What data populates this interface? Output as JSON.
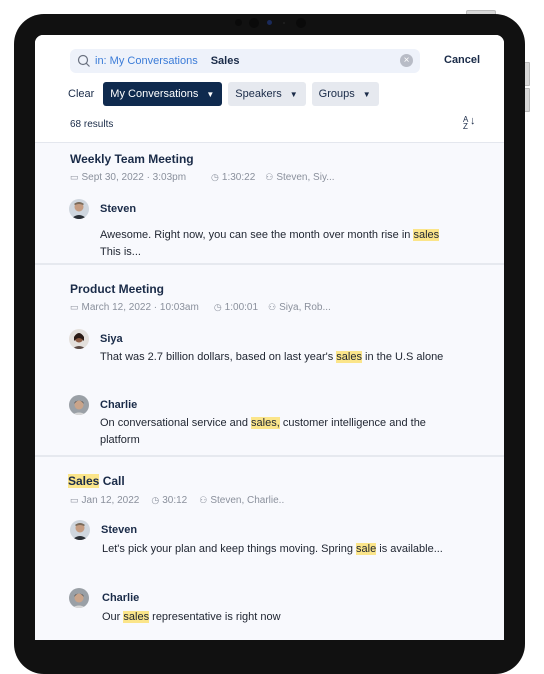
{
  "search": {
    "scope": "in: My Conversations",
    "query": "Sales",
    "cancel_label": "Cancel"
  },
  "filters": {
    "clear_label": "Clear",
    "chips": [
      {
        "label": "My Conversations",
        "active": true
      },
      {
        "label": "Speakers",
        "active": false
      },
      {
        "label": "Groups",
        "active": false
      }
    ]
  },
  "results": {
    "count_label": "68 results",
    "sort_icon": "sort-az-icon"
  },
  "colors": {
    "accent": "#0f2a4e",
    "highlight": "#fbe58a",
    "link": "#3b7cd8"
  },
  "conversations": [
    {
      "title": "Weekly Team Meeting",
      "date": "Sept 30, 2022 · 3:03pm",
      "duration": "1:30:22",
      "participants": "Steven, Siy...",
      "snippets": [
        {
          "speaker": "Steven",
          "before": "Awesome. Right now, you can see the month over month rise in ",
          "match": "sales",
          "after": " This is..."
        }
      ]
    },
    {
      "title": "Product Meeting",
      "date": "March 12, 2022 · 10:03am",
      "duration": "1:00:01",
      "participants": "Siya, Rob...",
      "snippets": [
        {
          "speaker": "Siya",
          "before": "That was 2.7 billion dollars, based on last year's ",
          "match": "sales",
          "after": " in the U.S alone"
        },
        {
          "speaker": "Charlie",
          "before": "On conversational service and ",
          "match": "sales,",
          "after": " customer intelligence and the platform"
        }
      ]
    },
    {
      "title_match": "Sales",
      "title_rest": " Call",
      "date": "Jan 12, 2022",
      "duration": "30:12",
      "participants": "Steven, Charlie..",
      "snippets": [
        {
          "speaker": "Steven",
          "before": "Let's pick your plan and keep things moving. Spring ",
          "match": "sale",
          "after": " is available..."
        },
        {
          "speaker": "Charlie",
          "before": "Our ",
          "match": "sales",
          "after": " representative is right now"
        }
      ]
    }
  ]
}
